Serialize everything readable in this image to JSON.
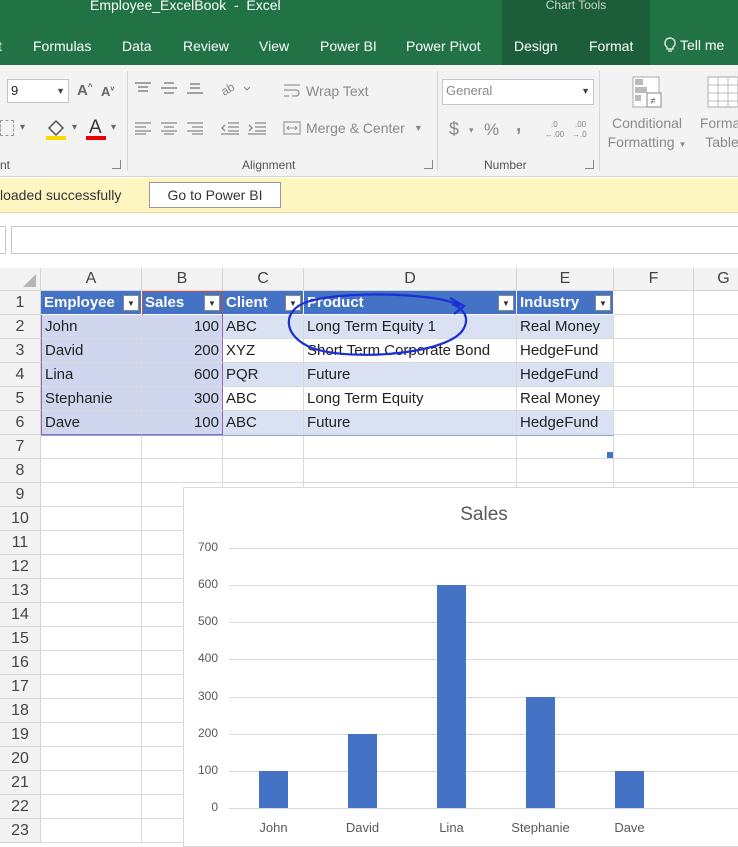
{
  "window": {
    "title": "Employee_ExcelBook  -  Excel",
    "context_tab_group": "Chart Tools"
  },
  "tabs": [
    "t",
    "Formulas",
    "Data",
    "Review",
    "View",
    "Power BI",
    "Power Pivot",
    "Design",
    "Format"
  ],
  "tell_me": "Tell me",
  "ribbon": {
    "font_size": "9",
    "wrap_text": "Wrap Text",
    "merge_center": "Merge & Center",
    "number_format": "General",
    "currency_symbol": "$",
    "percent_symbol": "%",
    "comma_symbol": ",",
    "conditional_formatting": [
      "Conditional",
      "Formatting"
    ],
    "format_as_table": [
      "Format",
      "Table"
    ],
    "groups": {
      "font": "nt",
      "alignment": "Alignment",
      "number": "Number"
    }
  },
  "notification": {
    "text": "loaded successfully",
    "button": "Go to Power BI"
  },
  "sheet": {
    "columns": [
      "A",
      "B",
      "C",
      "D",
      "E",
      "F",
      "G"
    ],
    "rows": [
      "1",
      "2",
      "3",
      "4",
      "5",
      "6",
      "7",
      "8",
      "9",
      "10",
      "11",
      "12",
      "13",
      "14",
      "15",
      "16",
      "17",
      "18",
      "19",
      "20",
      "21",
      "22",
      "23"
    ],
    "table_headers": [
      "Employee",
      "Sales",
      "Client",
      "Product",
      "Industry"
    ],
    "table_rows": [
      [
        "John",
        "100",
        "ABC",
        "Long Term Equity 1",
        "Real Money"
      ],
      [
        "David",
        "200",
        "XYZ",
        "Short Term Corporate Bond",
        "HedgeFund"
      ],
      [
        "Lina",
        "600",
        "PQR",
        "Future",
        "HedgeFund"
      ],
      [
        "Stephanie",
        "300",
        "ABC",
        "Long Term Equity",
        "Real Money"
      ],
      [
        "Dave",
        "100",
        "ABC",
        "Future",
        "HedgeFund"
      ]
    ]
  },
  "colors": {
    "excel_green": "#217346",
    "table_header": "#4472c4",
    "band": "#d9e1f2",
    "bar": "#4472c4",
    "annotation": "#1a2fd6"
  },
  "chart_data": {
    "type": "bar",
    "title": "Sales",
    "categories": [
      "John",
      "David",
      "Lina",
      "Stephanie",
      "Dave"
    ],
    "values": [
      100,
      200,
      600,
      300,
      100
    ],
    "yticks": [
      "0",
      "100",
      "200",
      "300",
      "400",
      "500",
      "600",
      "700"
    ],
    "ylim": [
      0,
      700
    ],
    "grid": true,
    "legend": "none"
  }
}
